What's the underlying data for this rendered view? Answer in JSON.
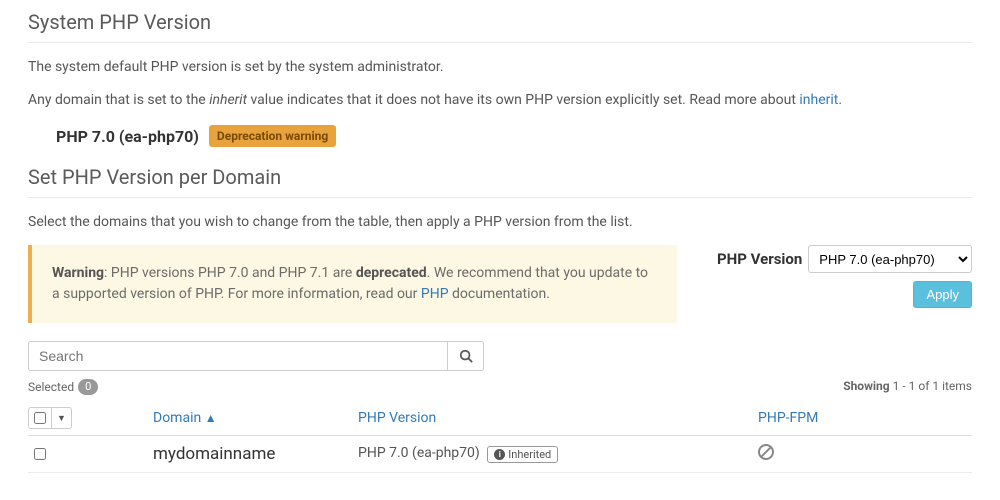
{
  "section1": {
    "title": "System PHP Version",
    "desc1": "The system default PHP version is set by the system administrator.",
    "desc2_pre": "Any domain that is set to the ",
    "desc2_em": "inherit",
    "desc2_mid": " value indicates that it does not have its own PHP version explicitly set. Read more about ",
    "desc2_link": "inherit",
    "desc2_end": ".",
    "system_version": "PHP 7.0 (ea-php70)",
    "deprecation_badge": "Deprecation warning"
  },
  "section2": {
    "title": "Set PHP Version per Domain",
    "desc": "Select the domains that you wish to change from the table, then apply a PHP version from the list."
  },
  "alert": {
    "strong1": "Warning",
    "text1": ": PHP versions PHP 7.0 and PHP 7.1 are ",
    "strong2": "deprecated",
    "text2": ". We recommend that you update to a supported version of PHP. For more information, read our ",
    "link": "PHP",
    "text3": " documentation."
  },
  "version_picker": {
    "label": "PHP Version",
    "selected": "PHP 7.0 (ea-php70)",
    "apply": "Apply"
  },
  "search": {
    "placeholder": "Search"
  },
  "status": {
    "selected_label": "Selected",
    "selected_count": "0",
    "showing_label": "Showing",
    "showing_range": " 1 - 1 of 1 items"
  },
  "table": {
    "headers": {
      "domain": "Domain",
      "domain_sort": "▲",
      "phpver": "PHP Version",
      "fpm": "PHP-FPM"
    },
    "rows": [
      {
        "domain": "mydomainname",
        "phpver": "PHP 7.0 (ea-php70)",
        "inherited": "Inherited"
      }
    ]
  }
}
